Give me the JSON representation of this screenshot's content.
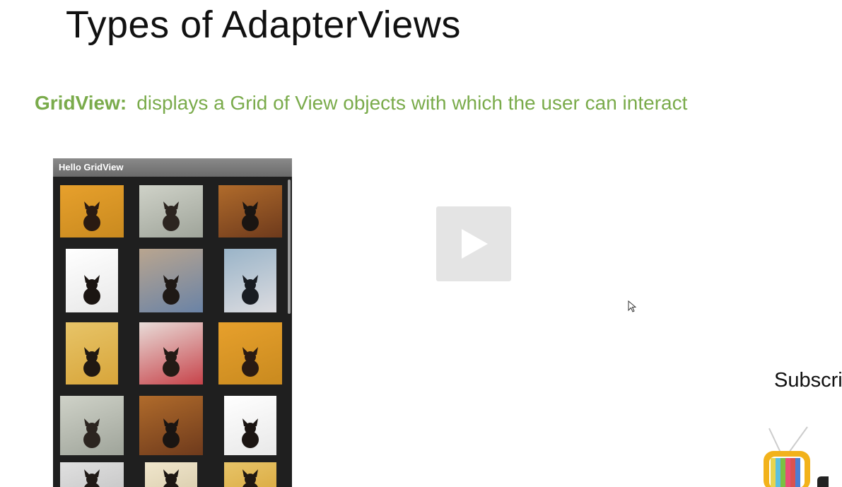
{
  "slide": {
    "title": "Types of AdapterViews",
    "subtitle_term": "GridView:",
    "subtitle_text": "displays a Grid of View objects with which the user can interact"
  },
  "phone": {
    "app_title": "Hello GridView"
  },
  "video": {
    "play_icon": "play-icon"
  },
  "overlay": {
    "subscribe_text": "Subscri"
  },
  "colors": {
    "accent_green": "#7aab4b",
    "phone_bg": "#1f1f1f",
    "titlebar": "#7a7a7a",
    "play_bg": "#e4e4e4"
  }
}
